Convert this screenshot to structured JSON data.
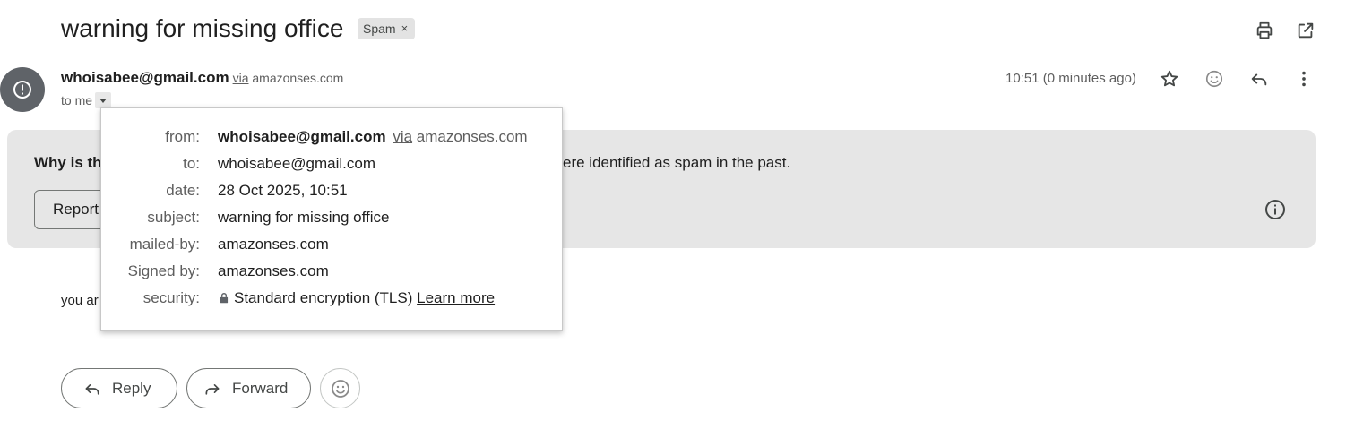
{
  "email": {
    "subject": "warning for missing office",
    "label_chip": "Spam",
    "label_remove": "×",
    "sender_email": "whoisabee@gmail.com",
    "via_word": "via",
    "via_domain": "amazonses.com",
    "to_line": "to me",
    "time": "10:51 (0 minutes ago)",
    "body_preview": "you ar"
  },
  "banner": {
    "question": "Why is th",
    "explanation": "ere identified as spam in the past.",
    "report_button": "Report"
  },
  "details_popup": {
    "from_label": "from:",
    "from_value": "whoisabee@gmail.com",
    "from_via": "via",
    "from_domain": "amazonses.com",
    "to_label": "to:",
    "to_value": "whoisabee@gmail.com",
    "date_label": "date:",
    "date_value": "28 Oct 2025, 10:51",
    "subject_label": "subject:",
    "subject_value": "warning for missing office",
    "mailed_by_label": "mailed-by:",
    "mailed_by_value": "amazonses.com",
    "signed_by_label": "Signed by:",
    "signed_by_value": "amazonses.com",
    "security_label": "security:",
    "security_value": "Standard encryption (TLS)",
    "learn_more": "Learn more"
  },
  "actions": {
    "reply": "Reply",
    "forward": "Forward"
  },
  "icons": {
    "print": "print-icon",
    "open_new_window": "open-in-new-window-icon",
    "warning_avatar": "warning-icon",
    "star": "star-icon",
    "emoji": "emoji-icon",
    "reply": "reply-icon",
    "more": "more-vert-icon",
    "info": "info-icon",
    "forward": "forward-icon",
    "lock": "lock-icon",
    "dropdown": "caret-down-icon"
  }
}
